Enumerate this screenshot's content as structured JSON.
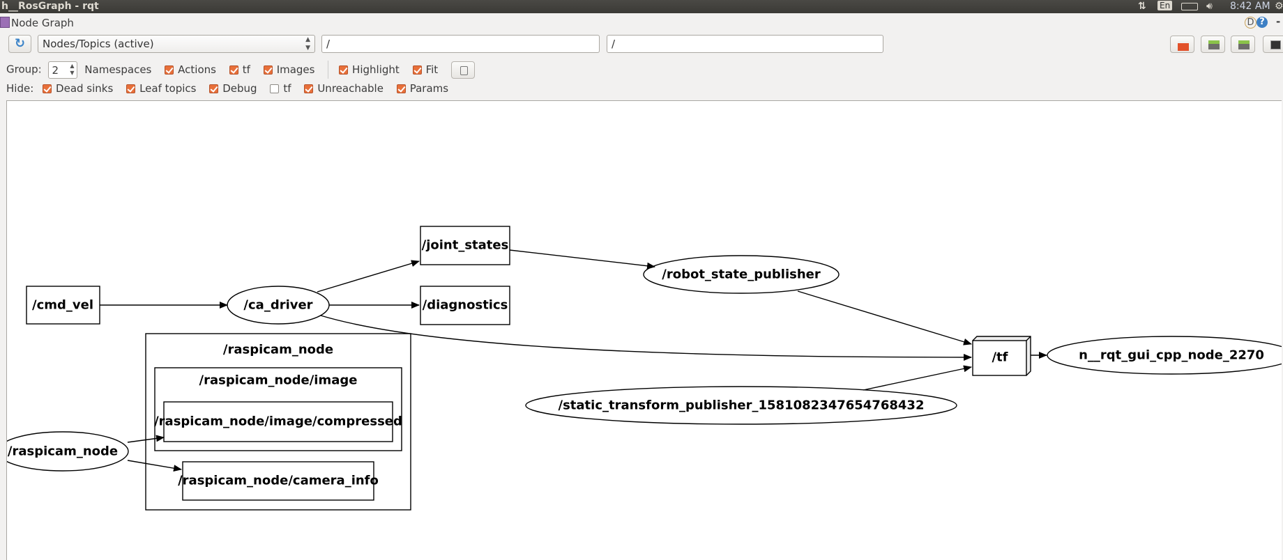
{
  "topbar": {
    "window_title": "h__RosGraph - rqt",
    "keyboard_layout": "En",
    "clock": "8:42 AM"
  },
  "plugin": {
    "title": "Node Graph",
    "help_labels": [
      "D",
      "?"
    ],
    "minimize": "-"
  },
  "toolbar": {
    "graph_type": "Nodes/Topics (active)",
    "node_filter": "/",
    "topic_filter": "/",
    "group_label": "Group:",
    "group_value": "2",
    "options": [
      {
        "label": "Namespaces",
        "checkbox": false
      },
      {
        "label": "Actions",
        "checked": true
      },
      {
        "label": "tf",
        "checked": true
      },
      {
        "label": "Images",
        "checked": true
      },
      {
        "label": "Highlight",
        "checked": true
      },
      {
        "label": "Fit",
        "checked": true
      }
    ],
    "hide_label": "Hide:",
    "hide": [
      {
        "label": "Dead sinks",
        "checked": true
      },
      {
        "label": "Leaf topics",
        "checked": true
      },
      {
        "label": "Debug",
        "checked": true
      },
      {
        "label": "tf",
        "checked": false
      },
      {
        "label": "Unreachable",
        "checked": true
      },
      {
        "label": "Params",
        "checked": true
      }
    ],
    "right_buttons": [
      "load-icon",
      "save-dot-icon",
      "save-image-icon",
      "screenshot-icon"
    ]
  },
  "graph": {
    "nodes": {
      "cmd_vel": "/cmd_vel",
      "ca_driver": "/ca_driver",
      "joint_states": "/joint_states",
      "diagnostics": "/diagnostics",
      "robot_state_publisher": "/robot_state_publisher",
      "tf": "/tf",
      "rqt_gui": "n__rqt_gui_cpp_node_2270",
      "static_tf": "/static_transform_publisher_1581082347654768432",
      "raspicam_node": "/raspicam_node",
      "compressed": "/raspicam_node/image/compressed",
      "camera_info": "/raspicam_node/camera_info"
    },
    "clusters": {
      "raspicam": "/raspicam_node",
      "image": "/raspicam_node/image"
    }
  }
}
